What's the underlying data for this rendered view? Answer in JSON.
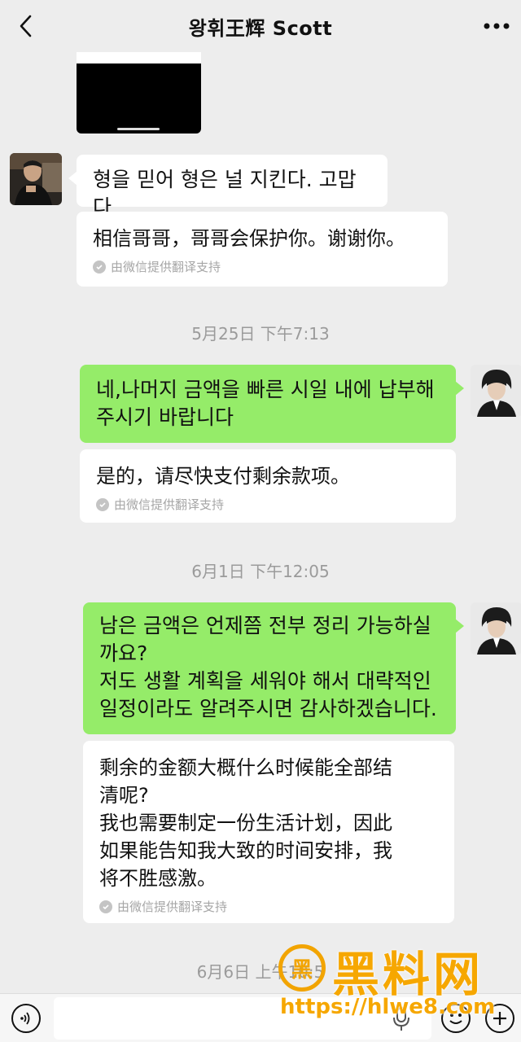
{
  "header": {
    "title": "왕휘王辉 Scott"
  },
  "messages": [
    {
      "id": "m1",
      "original": "형을 믿어 형은 널 지킨다. 고맙다",
      "translation": "相信哥哥，哥哥会保护你。谢谢你。"
    },
    {
      "id": "m2",
      "original": "네,나머지 금액을 빠른 시일 내에 납부해 주시기 바랍니다",
      "translation": "是的，请尽快支付剩余款项。"
    },
    {
      "id": "m3",
      "original_lines": [
        "남은 금액은 언제쯤 전부 정리 가능하실",
        "까요?",
        "저도 생활 계획을 세워야 해서 대략적인",
        "일정이라도 알려주시면 감사하겠습니다."
      ],
      "translation_lines": [
        "剩余的金额大概什么时候能全部结",
        "清呢?",
        "我也需要制定一份生活计划，因此",
        "如果能告知我大致的时间安排，我",
        "将不胜感激。"
      ]
    }
  ],
  "translation_note": "由微信提供翻译支持",
  "timestamps": {
    "t1": "5月25日 下午7:13",
    "t2": "6月1日 下午12:05",
    "t3": "6月6日 上午10:5"
  },
  "watermark": {
    "logo_text": "黑",
    "title": "黑料网",
    "url": "https://hlwe8.com"
  },
  "colors": {
    "background": "#ededed",
    "outgoing_bubble": "#95ec69",
    "incoming_bubble": "#ffffff",
    "watermark": "#f6a700"
  },
  "icons": {
    "back": "chevron-left-icon",
    "more": "more-dots-icon",
    "voice": "voice-icon",
    "mic": "mic-icon",
    "emoji": "emoji-icon",
    "plus": "plus-icon",
    "translate_check": "check-icon"
  }
}
